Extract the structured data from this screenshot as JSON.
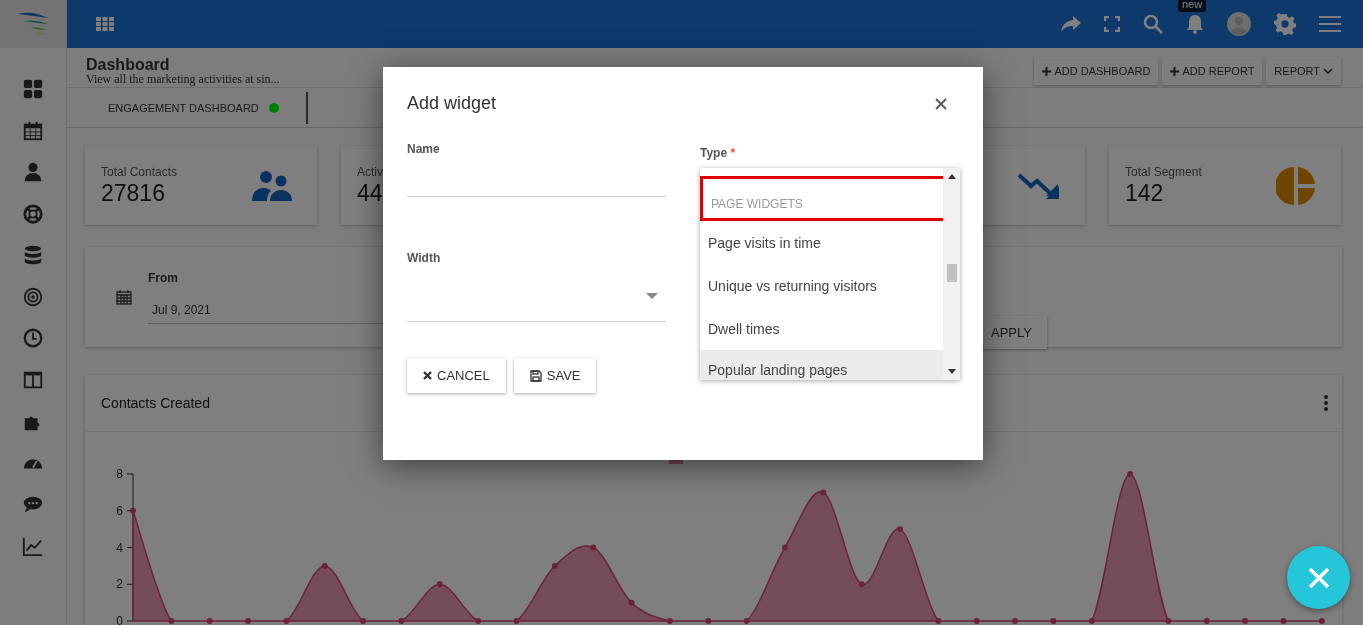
{
  "topbar": {
    "notification_badge": "new"
  },
  "page": {
    "title": "Dashboard",
    "subtitle": "View all the marketing activities at sin...",
    "actions": [
      {
        "label": "ADD DASHBOARD",
        "kind": "add"
      },
      {
        "label": "ADD REPORT",
        "kind": "add"
      },
      {
        "label": "REPORT",
        "kind": "menu"
      }
    ]
  },
  "tabs": [
    {
      "label": "ENGAGEMENT DASHBOARD",
      "color": "#008000"
    }
  ],
  "stats": [
    {
      "label": "Total Contacts",
      "value": "27816",
      "kind": "people"
    },
    {
      "label": "Activ",
      "value": "44"
    },
    {
      "kind": "trend-down"
    },
    {
      "label": "Total Segment",
      "value": "142",
      "kind": "pie"
    }
  ],
  "date_filter": {
    "label": "From",
    "value": "Jul 9, 2021",
    "button": "APPLY"
  },
  "chart_card": {
    "title": "Contacts Created",
    "chart_data": {
      "type": "area",
      "ylim": [
        0,
        8
      ],
      "yticks": [
        0,
        2,
        4,
        6,
        8
      ],
      "series": [
        {
          "color": "#d6496f",
          "values": [
            6,
            0,
            0,
            0,
            0,
            3,
            0,
            0,
            2,
            0,
            0,
            3,
            4,
            1,
            0,
            0,
            0,
            4,
            7,
            2,
            5,
            0,
            0,
            0,
            0,
            0,
            8,
            0,
            0,
            0,
            0,
            0
          ]
        }
      ]
    }
  },
  "modal": {
    "title": "Add widget",
    "name_field": {
      "label": "Name"
    },
    "width_field": {
      "label": "Width"
    },
    "type_field": {
      "label": "Type",
      "required": "*"
    },
    "options": [
      {
        "kind": "header",
        "label": "PAGE WIDGETS",
        "outlined": true,
        "active": false
      },
      {
        "kind": "option",
        "label": "Page visits in time",
        "outlined": false,
        "active": false
      },
      {
        "kind": "option",
        "label": "Unique vs returning visitors",
        "outlined": false,
        "active": false
      },
      {
        "kind": "option",
        "label": "Dwell times",
        "outlined": false,
        "active": false
      },
      {
        "kind": "option",
        "label": "Popular landing pages",
        "outlined": false,
        "active": true
      }
    ],
    "buttons": [
      {
        "label": "CANCEL",
        "kind": "cancel"
      },
      {
        "label": "SAVE",
        "kind": "save"
      }
    ]
  }
}
